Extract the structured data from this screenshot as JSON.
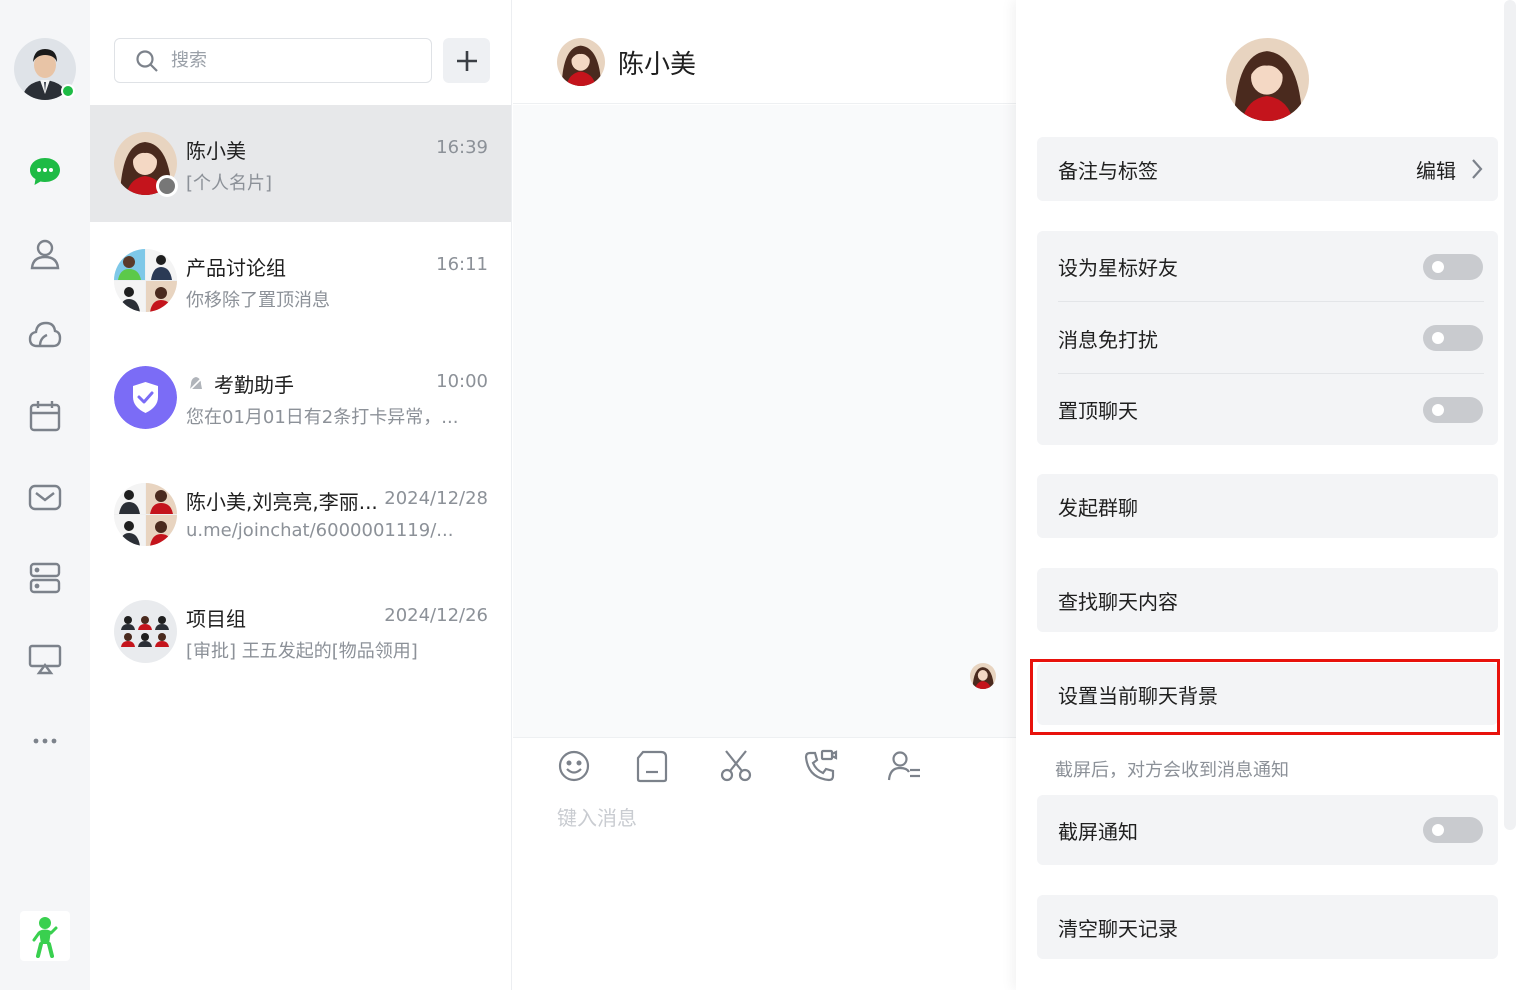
{
  "sidebar": {
    "nav": [
      "chat-icon",
      "contacts-icon",
      "moments-icon",
      "calendar-icon",
      "mail-icon",
      "storage-icon",
      "screen-cast-icon",
      "more-icon"
    ],
    "accent": "#1ebb45"
  },
  "list": {
    "search_placeholder": "搜索",
    "conversations": [
      {
        "name": "陈小美",
        "time": "16:39",
        "preview": "[个人名片]"
      },
      {
        "name": "产品讨论组",
        "time": "16:11",
        "preview": "你移除了置顶消息"
      },
      {
        "name": "考勤助手",
        "time": "10:00",
        "preview": "您在01月01日有2条打卡异常，..."
      },
      {
        "name": "陈小美,刘亮亮,李丽...",
        "time": "2024/12/28",
        "preview": "u.me/joinchat/6000001119/..."
      },
      {
        "name": "项目组",
        "time": "2024/12/26",
        "preview": "[审批] 王五发起的[物品领用]"
      }
    ]
  },
  "chat": {
    "title": "陈小美",
    "input_placeholder": "键入消息",
    "tools": [
      "emoji-icon",
      "file-icon",
      "scissors-icon",
      "video-call-icon",
      "contact-card-icon"
    ]
  },
  "panel": {
    "remark_label": "备注与标签",
    "edit_label": "编辑",
    "star_label": "设为星标好友",
    "mute_label": "消息免打扰",
    "pin_label": "置顶聊天",
    "group_label": "发起群聊",
    "search_label": "查找聊天内容",
    "bg_label": "设置当前聊天背景",
    "screenshot_hint": "截屏后，对方会收到消息通知",
    "screenshot_label": "截屏通知",
    "clear_label": "清空聊天记录",
    "highlight_color": "#e8120c"
  }
}
